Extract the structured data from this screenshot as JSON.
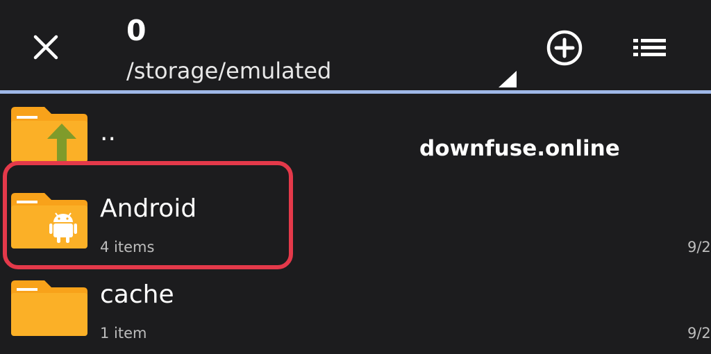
{
  "toolbar": {
    "close_icon": "close-icon",
    "count": "0",
    "path": "/storage/emulated",
    "add_icon": "add-circle-icon",
    "list_icon": "list-view-icon",
    "accent_color": "#9fb8e8"
  },
  "files": [
    {
      "name": "..",
      "meta": "",
      "date": "",
      "icon": "folder-up-icon"
    },
    {
      "name": "Android",
      "meta": "4 items",
      "date": "9/2",
      "icon": "android-folder-icon"
    },
    {
      "name": "cache",
      "meta": "1 item",
      "date": "9/2",
      "icon": "folder-icon"
    }
  ],
  "highlight_color": "#e4394a",
  "folder_color": "#f8a21a",
  "watermark": "downfuse.online"
}
